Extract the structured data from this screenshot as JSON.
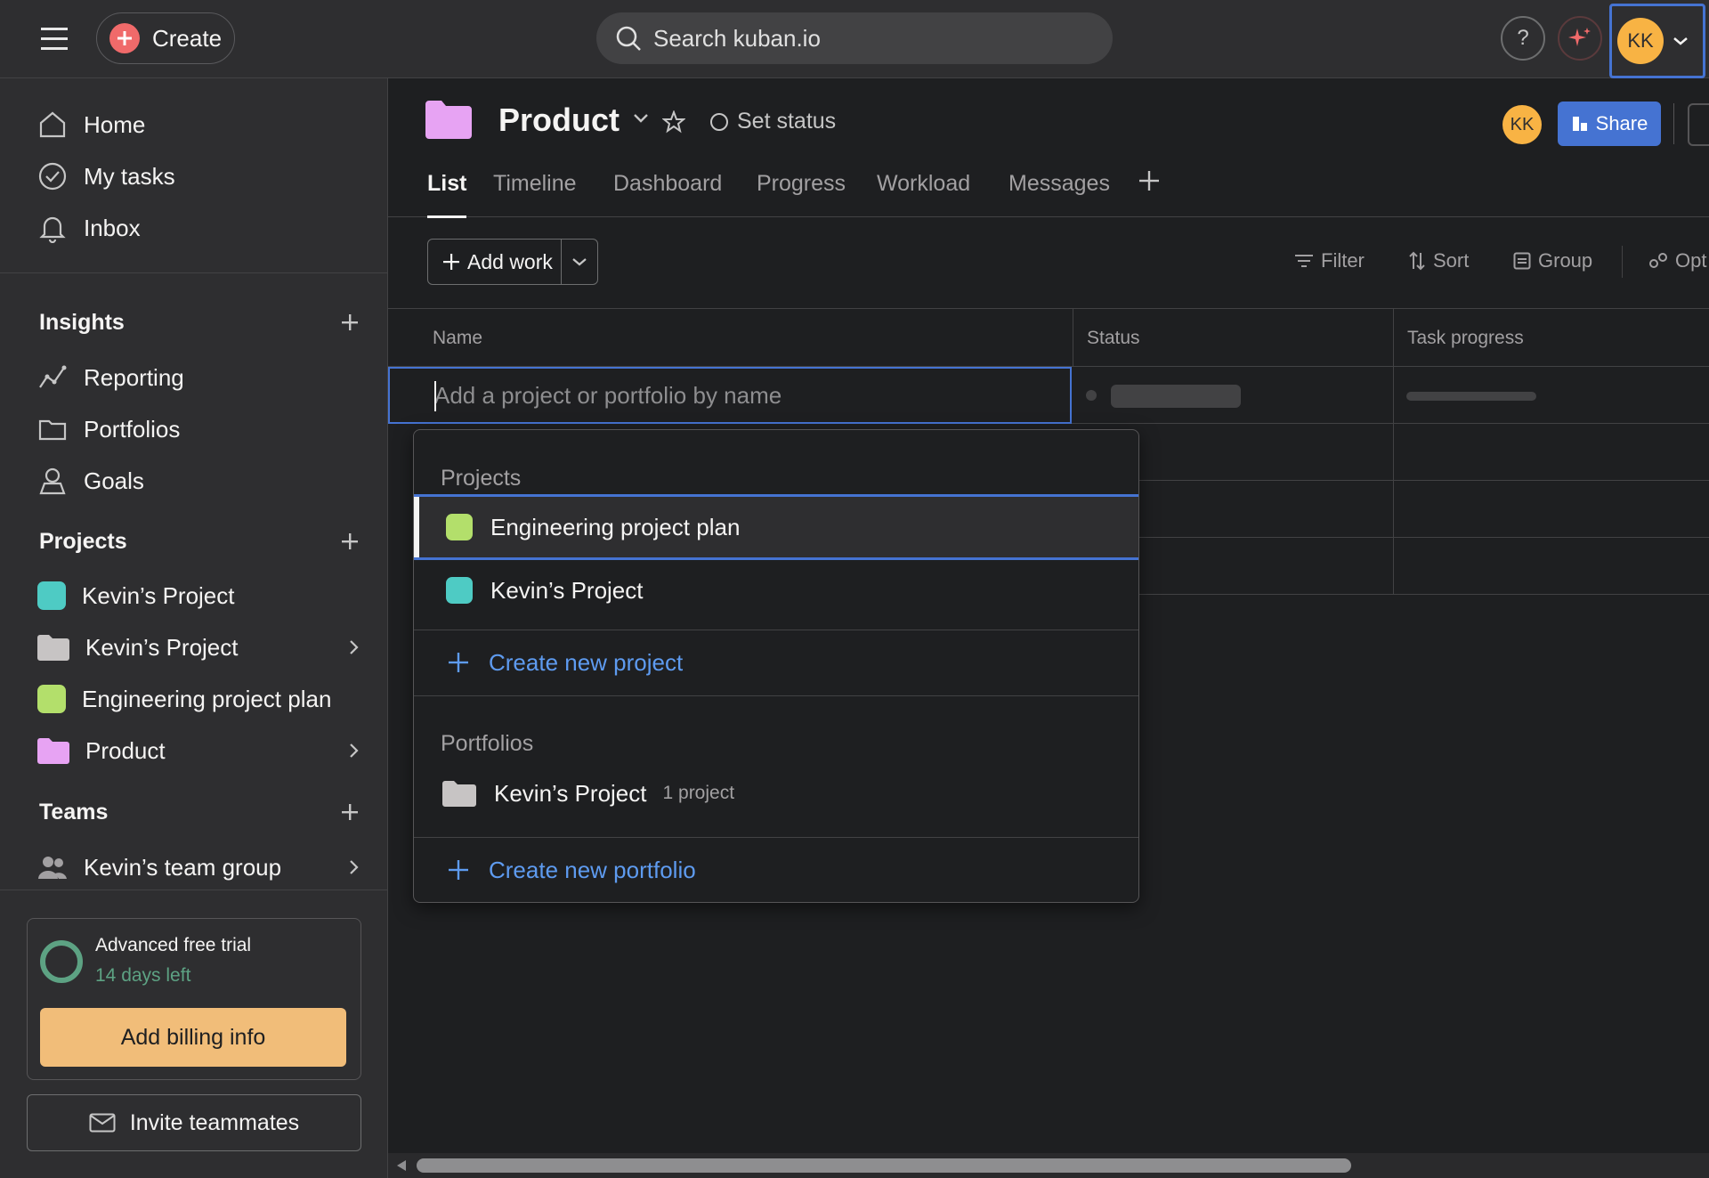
{
  "topbar": {
    "create_label": "Create",
    "search_placeholder": "Search kuban.io",
    "help_label": "?",
    "avatar_initials": "KK"
  },
  "sidebar": {
    "nav": [
      {
        "label": "Home",
        "icon": "home-icon"
      },
      {
        "label": "My tasks",
        "icon": "check-circle-icon"
      },
      {
        "label": "Inbox",
        "icon": "bell-icon"
      }
    ],
    "insights": {
      "title": "Insights",
      "items": [
        {
          "label": "Reporting",
          "icon": "chart-line-icon"
        },
        {
          "label": "Portfolios",
          "icon": "folder-icon"
        },
        {
          "label": "Goals",
          "icon": "person-icon"
        }
      ]
    },
    "projects": {
      "title": "Projects",
      "items": [
        {
          "label": "Kevin’s Project",
          "color": "#4ecbc4"
        },
        {
          "label": "Kevin’s Project",
          "color": "#c7c4c4"
        },
        {
          "label": "Engineering project plan",
          "color": "#b3df6b"
        },
        {
          "label": "Product",
          "color": "#e7a3f3"
        }
      ]
    },
    "teams": {
      "title": "Teams",
      "items": [
        {
          "label": "Kevin’s team group"
        }
      ]
    },
    "trial": {
      "title": "Advanced free trial",
      "days_left": "14 days left",
      "billing_label": "Add billing info"
    },
    "invite_label": "Invite teammates"
  },
  "header": {
    "project_title": "Product",
    "set_status": "Set status",
    "avatar_initials": "KK",
    "share_label": "Share",
    "tabs": [
      "List",
      "Timeline",
      "Dashboard",
      "Progress",
      "Workload",
      "Messages"
    ]
  },
  "toolbar": {
    "add_work": "Add work",
    "filter": "Filter",
    "sort": "Sort",
    "group": "Group",
    "options": "Opt"
  },
  "table": {
    "columns": [
      "Name",
      "Status",
      "Task progress"
    ],
    "input_placeholder": "Add a project or portfolio by name"
  },
  "dropdown": {
    "projects_header": "Projects",
    "projects": [
      {
        "label": "Engineering project plan",
        "color": "#b3df6b"
      },
      {
        "label": "Kevin’s Project",
        "color": "#4ecbc4"
      }
    ],
    "create_project": "Create new project",
    "portfolios_header": "Portfolios",
    "portfolios": [
      {
        "label": "Kevin’s Project",
        "meta": "1 project",
        "color": "#c7c4c4"
      }
    ],
    "create_portfolio": "Create new portfolio"
  }
}
